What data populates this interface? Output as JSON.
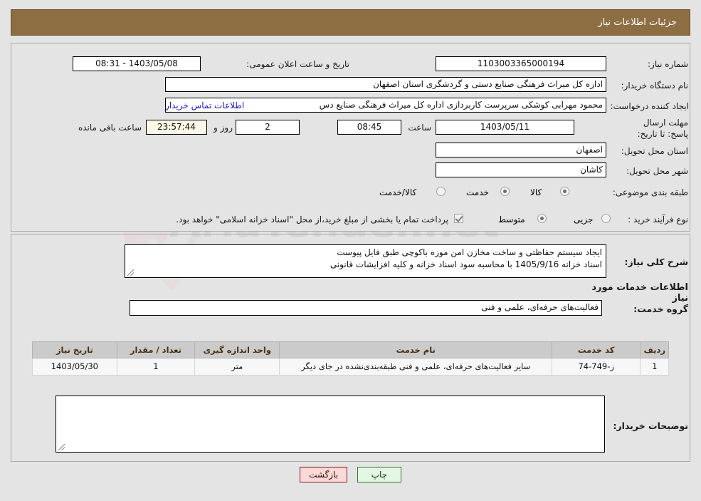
{
  "header": {
    "title": "جزئیات اطلاعات نیاز",
    "bg_color": "#8d6e43"
  },
  "form": {
    "need_number_label": "شماره نیاز:",
    "need_number_value": "1103003365000194",
    "public_announce_label": "تاریخ و ساعت اعلان عمومی:",
    "public_announce_value": "1403/05/08 - 08:31",
    "buyer_org_label": "نام دستگاه خریدار:",
    "buyer_org_value": "اداره کل میراث فرهنگی  صنایع دستی و گردشگری استان اصفهان",
    "requester_label": "ایجاد کننده درخواست:",
    "requester_value": "محمود مهرابی کوشکی سرپرست کاربردازی اداره کل میراث فرهنگی  صنایع دس",
    "contact_link": "اطلاعات تماس خریدار",
    "deadline_label": "مهلت ارسال پاسخ: تا تاریخ:",
    "deadline_date": "1403/05/11",
    "deadline_hour_label": "ساعت",
    "deadline_time": "08:45",
    "remaining_days": "2",
    "remaining_days_suffix": "روز و",
    "remaining_clock": "23:57:44",
    "remaining_clock_suffix": "ساعت باقی مانده",
    "province_label": "استان محل تحویل:",
    "province_value": "اصفهان",
    "city_label": "شهر محل تحویل:",
    "city_value": "کاشان",
    "category_label": "طبقه بندی موضوعی:",
    "category_options": [
      {
        "label": "کالا",
        "selected": false
      },
      {
        "label": "خدمت",
        "selected": true
      },
      {
        "label": "کالا/خدمت",
        "selected": false
      }
    ],
    "process_label": "نوع فرآیند خرید :",
    "process_options": [
      {
        "label": "جزیی",
        "selected": false
      },
      {
        "label": "متوسط",
        "selected": true
      }
    ],
    "treasury_checkbox_checked": true,
    "treasury_checkbox_label": "پرداخت تمام یا بخشی از مبلغ خرید،از محل \"اسناد خزانه اسلامی\" خواهد بود."
  },
  "description": {
    "label": "شرح کلی نیاز:",
    "line1": "ایجاد سیستم حفاظتی و ساخت مخازن امن موزه باکوچی طبق فایل پیوست",
    "line2": "اسناد خزانه 1405/9/16 با محاسبه سود اسناد خزانه و کلیه افزایشات قانونی"
  },
  "services": {
    "section_title": "اطلاعات خدمات مورد نیاز",
    "group_label": "گروه خدمت:",
    "group_value": "فعالیت‌های حرفه‌ای، علمی و فنی",
    "columns": [
      "ردیف",
      "کد خدمت",
      "نام خدمت",
      "واحد اندازه گیری",
      "تعداد / مقدار",
      "تاریخ نیاز"
    ],
    "rows": [
      {
        "row": "1",
        "code": "ز-749-74",
        "name": "سایر فعالیت‌های حرفه‌ای، علمی و فنی طبقه‌بندی‌نشده در جای دیگر",
        "unit": "متر",
        "qty": "1",
        "date": "1403/05/30"
      }
    ]
  },
  "buyer_notes": {
    "label": "توضیحات خریدار:",
    "value": ""
  },
  "buttons": {
    "print": "چاپ",
    "back": "بازگشت"
  },
  "watermark": {
    "text": "AriaTender.net"
  }
}
